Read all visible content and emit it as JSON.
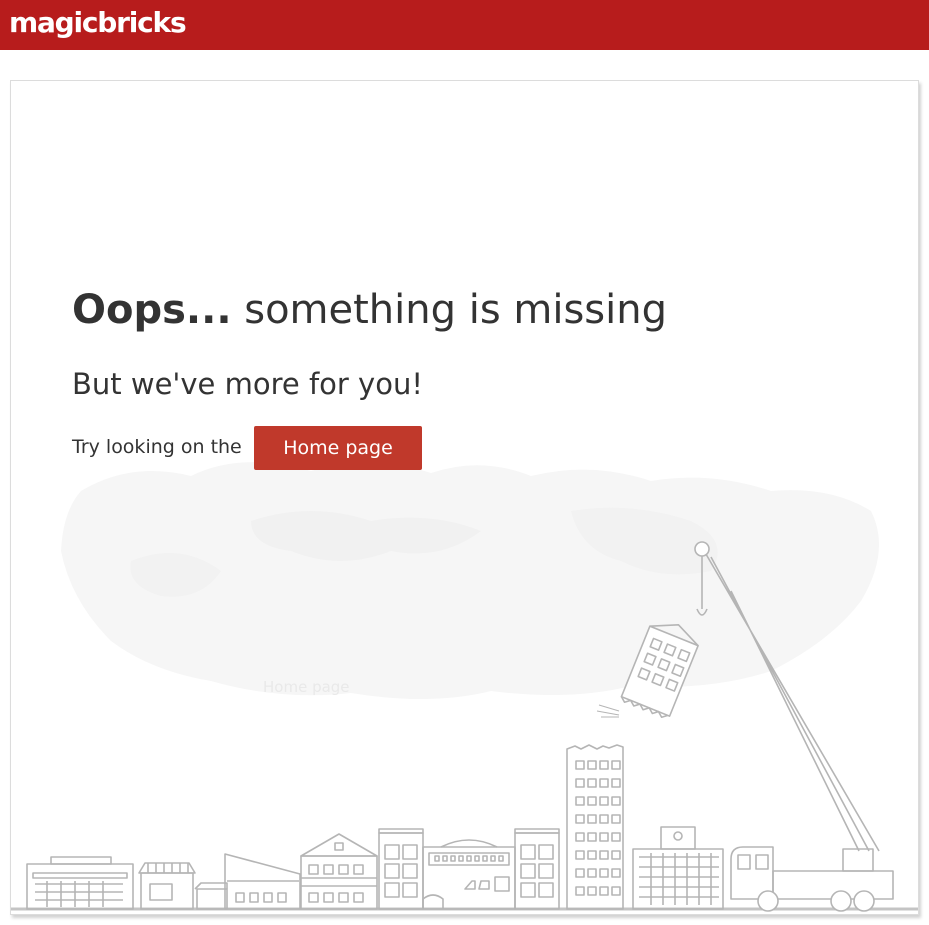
{
  "header": {
    "logo_text": "magicbricks",
    "bg_color": "#b71c1c"
  },
  "error": {
    "heading_bold": "Oops...",
    "heading_rest": " something is missing",
    "subheading": "But we've more for you!",
    "try_text": "Try looking on the",
    "home_button_label": "Home page",
    "button_color": "#c0392b"
  },
  "illustration": {
    "watermark_text": "Home page",
    "icon": "city-skyline-with-crane-icon"
  }
}
